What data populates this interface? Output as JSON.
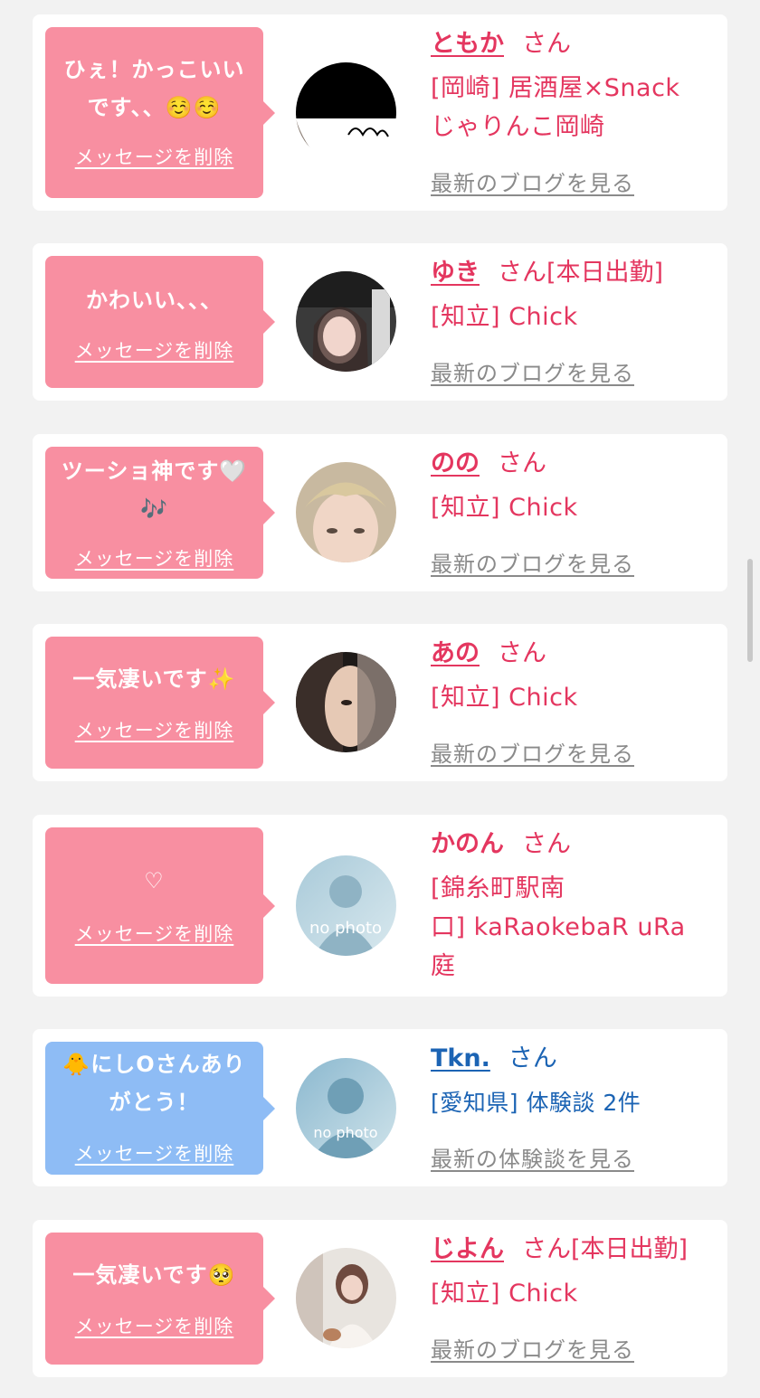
{
  "delete_label": "メッセージを削除",
  "san_suffix": "さん",
  "blog_link": "最新のブログを見る",
  "review_link": "最新の体験談を見る",
  "colors": {
    "pink_bubble": "#f88fa1",
    "blue_bubble": "#8ebcf5",
    "pink_text": "#e4365f",
    "blue_text": "#1c64b4"
  },
  "messages": [
    {
      "bubble_line1": "ひぇ！かっこいい",
      "bubble_line2": "です、、☺️☺️",
      "name": "ともか",
      "san": "さん",
      "shop_line1": "[岡崎] 居酒屋×Snack",
      "shop_line2": "じゃりんこ岡崎",
      "link": "最新のブログを見る"
    },
    {
      "bubble_line1": "かわいい、、、",
      "name": "ゆき",
      "san": "さん[本日出勤]",
      "shop_line1": "[知立] Chick",
      "link": "最新のブログを見る"
    },
    {
      "bubble_line1": "ツーショ神です🤍",
      "bubble_line2": "🎶",
      "name": "のの",
      "san": "さん",
      "shop_line1": "[知立] Chick",
      "link": "最新のブログを見る"
    },
    {
      "bubble_line1": "一気凄いです✨",
      "name": "あの",
      "san": "さん",
      "shop_line1": "[知立] Chick",
      "link": "最新のブログを見る"
    },
    {
      "bubble_line1": "♡",
      "name": "かのん",
      "san": "さん",
      "shop_line1": "[錦糸町駅南",
      "shop_line2": "口] kaRaokebaR uRa",
      "shop_line3": "庭",
      "avatar_label": "no photo"
    },
    {
      "bubble_line1": "🐥にしOさんあり",
      "bubble_line2": "がとう！",
      "name": "Tkn.",
      "san": "さん",
      "shop_line1": "[愛知県] 体験談 2件",
      "link": "最新の体験談を見る",
      "avatar_label": "no photo"
    },
    {
      "bubble_line1": "一気凄いです🥺",
      "name": "じよん",
      "san": "さん[本日出勤]",
      "shop_line1": "[知立] Chick",
      "link": "最新のブログを見る"
    }
  ]
}
